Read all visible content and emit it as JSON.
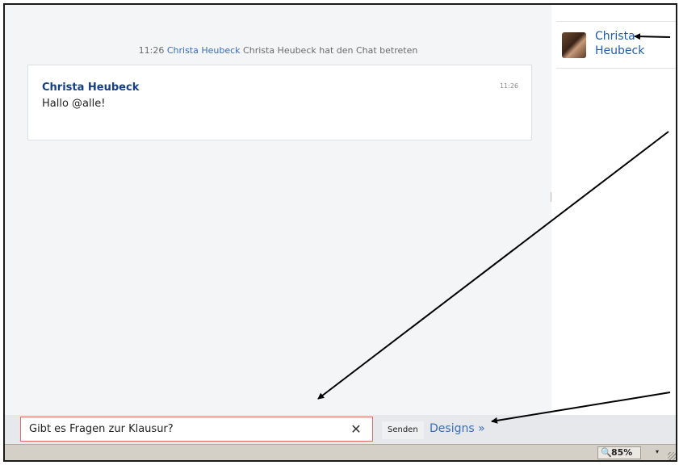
{
  "system_message": {
    "time": "11:26",
    "user_link": "Christa Heubeck",
    "text": "Christa Heubeck hat den Chat betreten"
  },
  "message": {
    "author": "Christa Heubeck",
    "time": "11:26",
    "text": "Hallo @alle!"
  },
  "user_list": {
    "users": [
      {
        "first_name": "Christa",
        "last_name": "Heubeck"
      }
    ]
  },
  "composer": {
    "input_value": "Gibt es Fragen zur Klausur?",
    "clear_glyph": "✕",
    "send_label": "Senden",
    "designs_label": "Designs »"
  },
  "status_bar": {
    "zoom": "85%",
    "zoom_icon": "zoom-icon",
    "dropdown_glyph": "▾"
  },
  "colors": {
    "link": "#3a6db5",
    "author": "#153f80",
    "input_border": "#e06a6a",
    "chat_bg": "#f3f5f7"
  }
}
